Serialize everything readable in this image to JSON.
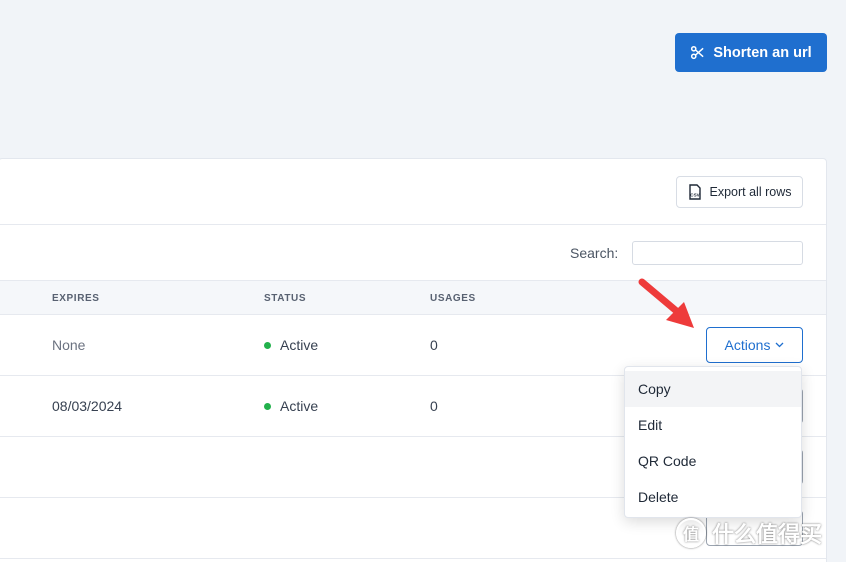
{
  "header": {
    "shorten_label": "Shorten an url",
    "shorten_icon": "scissors-icon"
  },
  "toolbar": {
    "export_label": "Export all rows",
    "export_icon": "csv-file-icon"
  },
  "search": {
    "label": "Search:",
    "value": "",
    "placeholder": ""
  },
  "table": {
    "columns": [
      "EXPIRES",
      "STATUS",
      "USAGES"
    ],
    "rows": [
      {
        "expires": "None",
        "status": "Active",
        "usages": "0",
        "action_label": "Actions"
      },
      {
        "expires": "08/03/2024",
        "status": "Active",
        "usages": "0"
      }
    ]
  },
  "dropdown": {
    "items": [
      "Copy",
      "Edit",
      "QR Code",
      "Delete"
    ]
  },
  "annotation": {
    "arrow_color": "#ee3b3b"
  },
  "watermark": {
    "text": "值 什么值得买"
  },
  "colors": {
    "primary": "#1f6fcf",
    "status_active": "#22b14c"
  }
}
